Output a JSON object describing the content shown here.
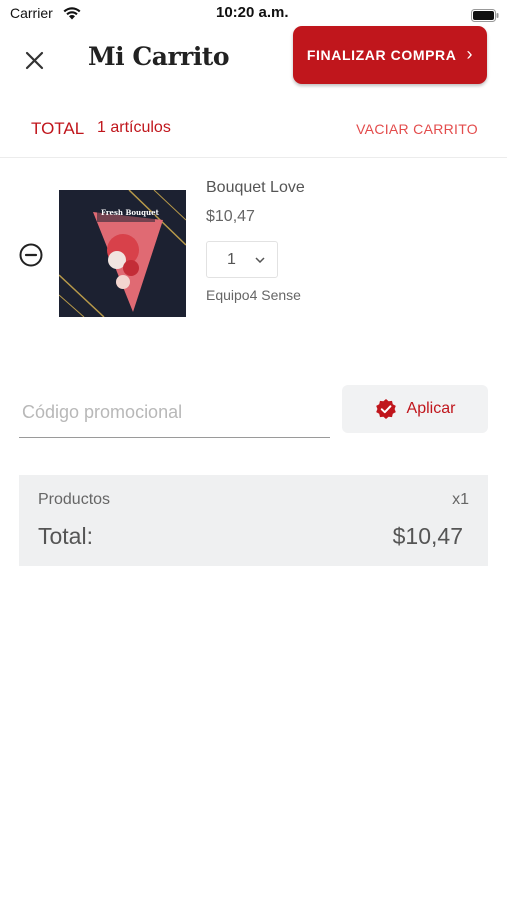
{
  "status_bar": {
    "carrier": "Carrier",
    "time": "10:20 a.m."
  },
  "header": {
    "title": "Mi Carrito",
    "checkout_label": "FINALIZAR COMPRA",
    "checkout_chevron": "›"
  },
  "total_row": {
    "label": "TOTAL",
    "count_text": "1 artículos",
    "clear_label": "VACIAR CARRITO"
  },
  "cart_items": [
    {
      "name": "Bouquet Love",
      "price": "$10,47",
      "quantity": "1",
      "seller": "Equipo4 Sense",
      "image_text": "Fresh Bouquet"
    }
  ],
  "promo": {
    "placeholder": "Código promocional",
    "value": "",
    "apply_label": "Aplicar"
  },
  "summary": {
    "products_label": "Productos",
    "products_count": "x1",
    "total_label": "Total:",
    "total_value": "$10,47"
  },
  "colors": {
    "accent": "#c0161c",
    "clear_text": "#e34c4c",
    "summary_bg": "#eff0f1"
  },
  "icons": {
    "close": "close-icon",
    "remove": "minus-circle-icon",
    "apply": "verified-badge-icon",
    "qty": "chevron-down-icon"
  }
}
